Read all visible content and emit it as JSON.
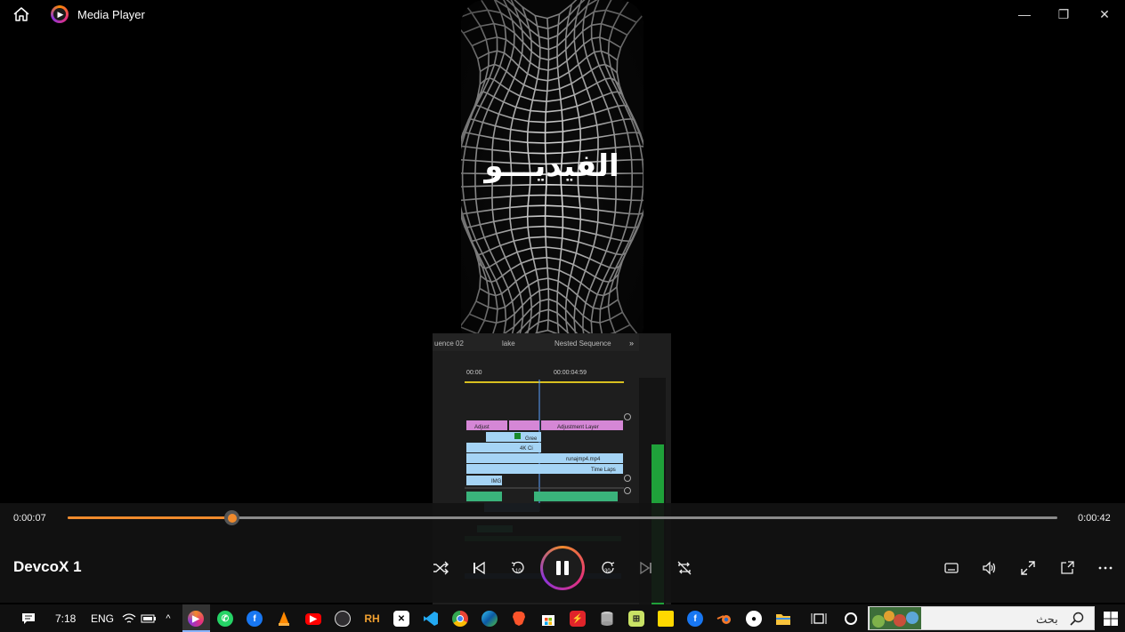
{
  "window": {
    "title": "Media Player",
    "minimize_glyph": "—",
    "restore_glyph": "❐",
    "close_glyph": "✕"
  },
  "video": {
    "overlay_text": "الفيديـــو",
    "editor": {
      "tabs": [
        "uence 02",
        "lake",
        "Nested Sequence"
      ],
      "expand_glyph": "»",
      "timecodes": [
        "00:00",
        "00:00:04:59"
      ],
      "clip_labels": [
        "Adjust",
        "Adjustment Layer",
        "Gree",
        "4K Ci",
        "runajmp4.mp4",
        "Time Laps",
        "IMG"
      ],
      "clip_fx": "fx"
    }
  },
  "player": {
    "current_time": "0:00:07",
    "total_time": "0:00:42",
    "progress_fraction": 0.166,
    "media_title": "DevcoX 1",
    "rewind_seconds": "10",
    "forward_seconds": "30",
    "accent_color": "#f08a2c"
  },
  "taskbar": {
    "clock": "7:18",
    "language": "ENG",
    "search_placeholder": "بحث",
    "tray_chevron": "^"
  }
}
